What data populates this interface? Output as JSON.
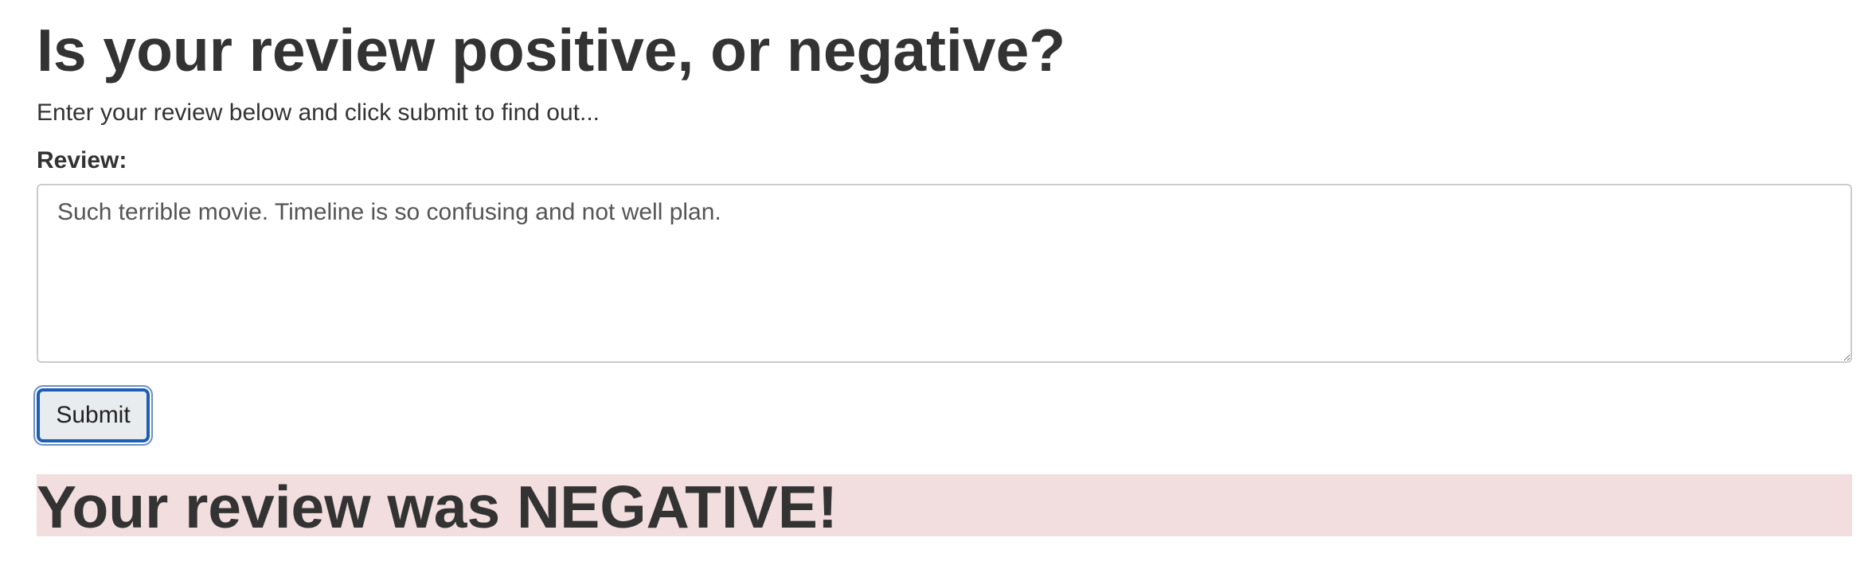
{
  "page": {
    "title": "Is your review positive, or negative?",
    "intro": "Enter your review below and click submit to find out..."
  },
  "form": {
    "review_label": "Review:",
    "review_value": "Such terrible movie. Timeline is so confusing and not well plan.",
    "submit_label": "Submit"
  },
  "result": {
    "text": "Your review was NEGATIVE!",
    "sentiment": "negative",
    "background_color": "#f2dede"
  }
}
